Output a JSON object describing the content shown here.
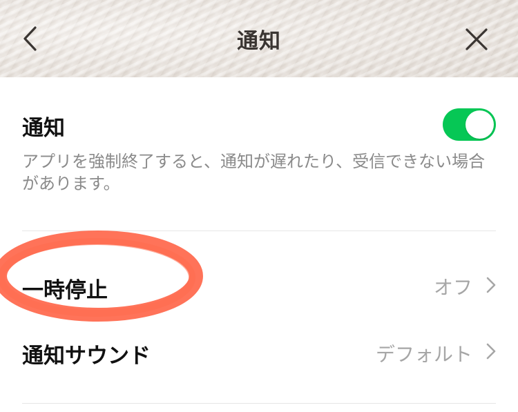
{
  "header": {
    "title": "通知",
    "back_icon": "chevron-left-icon",
    "close_icon": "close-icon"
  },
  "notifications": {
    "title": "通知",
    "toggle_on": true,
    "description": "アプリを強制終了すると、通知が遅れたり、受信できない場合があります。"
  },
  "pause": {
    "label": "一時停止",
    "value": "オフ"
  },
  "sound": {
    "label": "通知サウンド",
    "value": "デフォルト"
  },
  "colors": {
    "toggle_on": "#06c755",
    "annotation": "#ff5a3c",
    "secondary_text": "#8a8a8a"
  }
}
